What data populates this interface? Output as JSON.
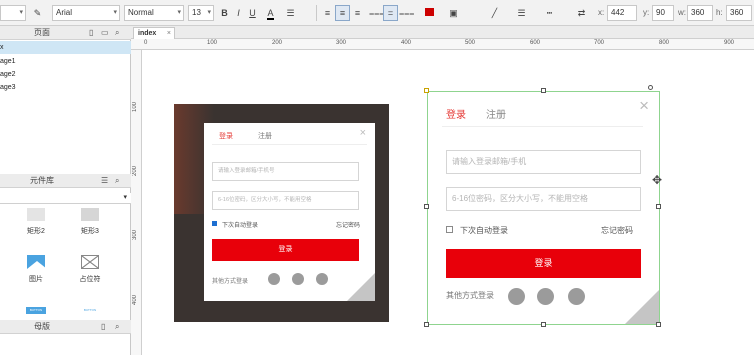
{
  "toolbar": {
    "font_family": "Arial",
    "style": "Normal",
    "font_size": "13",
    "bold": "B",
    "italic": "I",
    "underline": "U",
    "font_color_label": "A",
    "x_label": "x:",
    "x_value": "442",
    "y_label": "y:",
    "y_value": "90",
    "w_label": "w:",
    "w_value": "360",
    "h_label": "h:",
    "h_value": "360",
    "accent_red": "#cc0000"
  },
  "left": {
    "pages_title": "页面",
    "pages": [
      "x",
      "age1",
      "age2",
      "age3"
    ],
    "library_title": "元件库",
    "library_items": [
      {
        "label": "矩形2",
        "icon": "rect-icon"
      },
      {
        "label": "矩形3",
        "icon": "rect-icon"
      },
      {
        "label": "图片",
        "icon": "image-icon"
      },
      {
        "label": "占位符",
        "icon": "placeholder-icon"
      }
    ],
    "button_label": "BUTTON",
    "button_label2": "BUTTON",
    "masters_title": "母版"
  },
  "canvas": {
    "tab": "index",
    "ruler_h": [
      "0",
      "100",
      "200",
      "300",
      "400",
      "500",
      "600",
      "700",
      "800",
      "900"
    ],
    "ruler_v": [
      "100",
      "200",
      "300",
      "400"
    ]
  },
  "login_small": {
    "tab_login": "登录",
    "tab_register": "注册",
    "close": "×",
    "phone_placeholder": "请输入登录邮箱/手机号",
    "password_placeholder": "6-16位密码，区分大小写，不能用空格",
    "auto_login": "下次自动登录",
    "forgot": "忘记密码",
    "submit": "登录",
    "other_login": "其他方式登录"
  },
  "login_large": {
    "tab_login": "登录",
    "tab_register": "注册",
    "close": "×",
    "phone_placeholder": "请输入登录邮箱/手机",
    "password_placeholder": "6-16位密码，区分大小写，不能用空格",
    "auto_login": "下次自动登录",
    "forgot": "忘记密码",
    "submit": "登录",
    "other_login": "其他方式登录"
  }
}
